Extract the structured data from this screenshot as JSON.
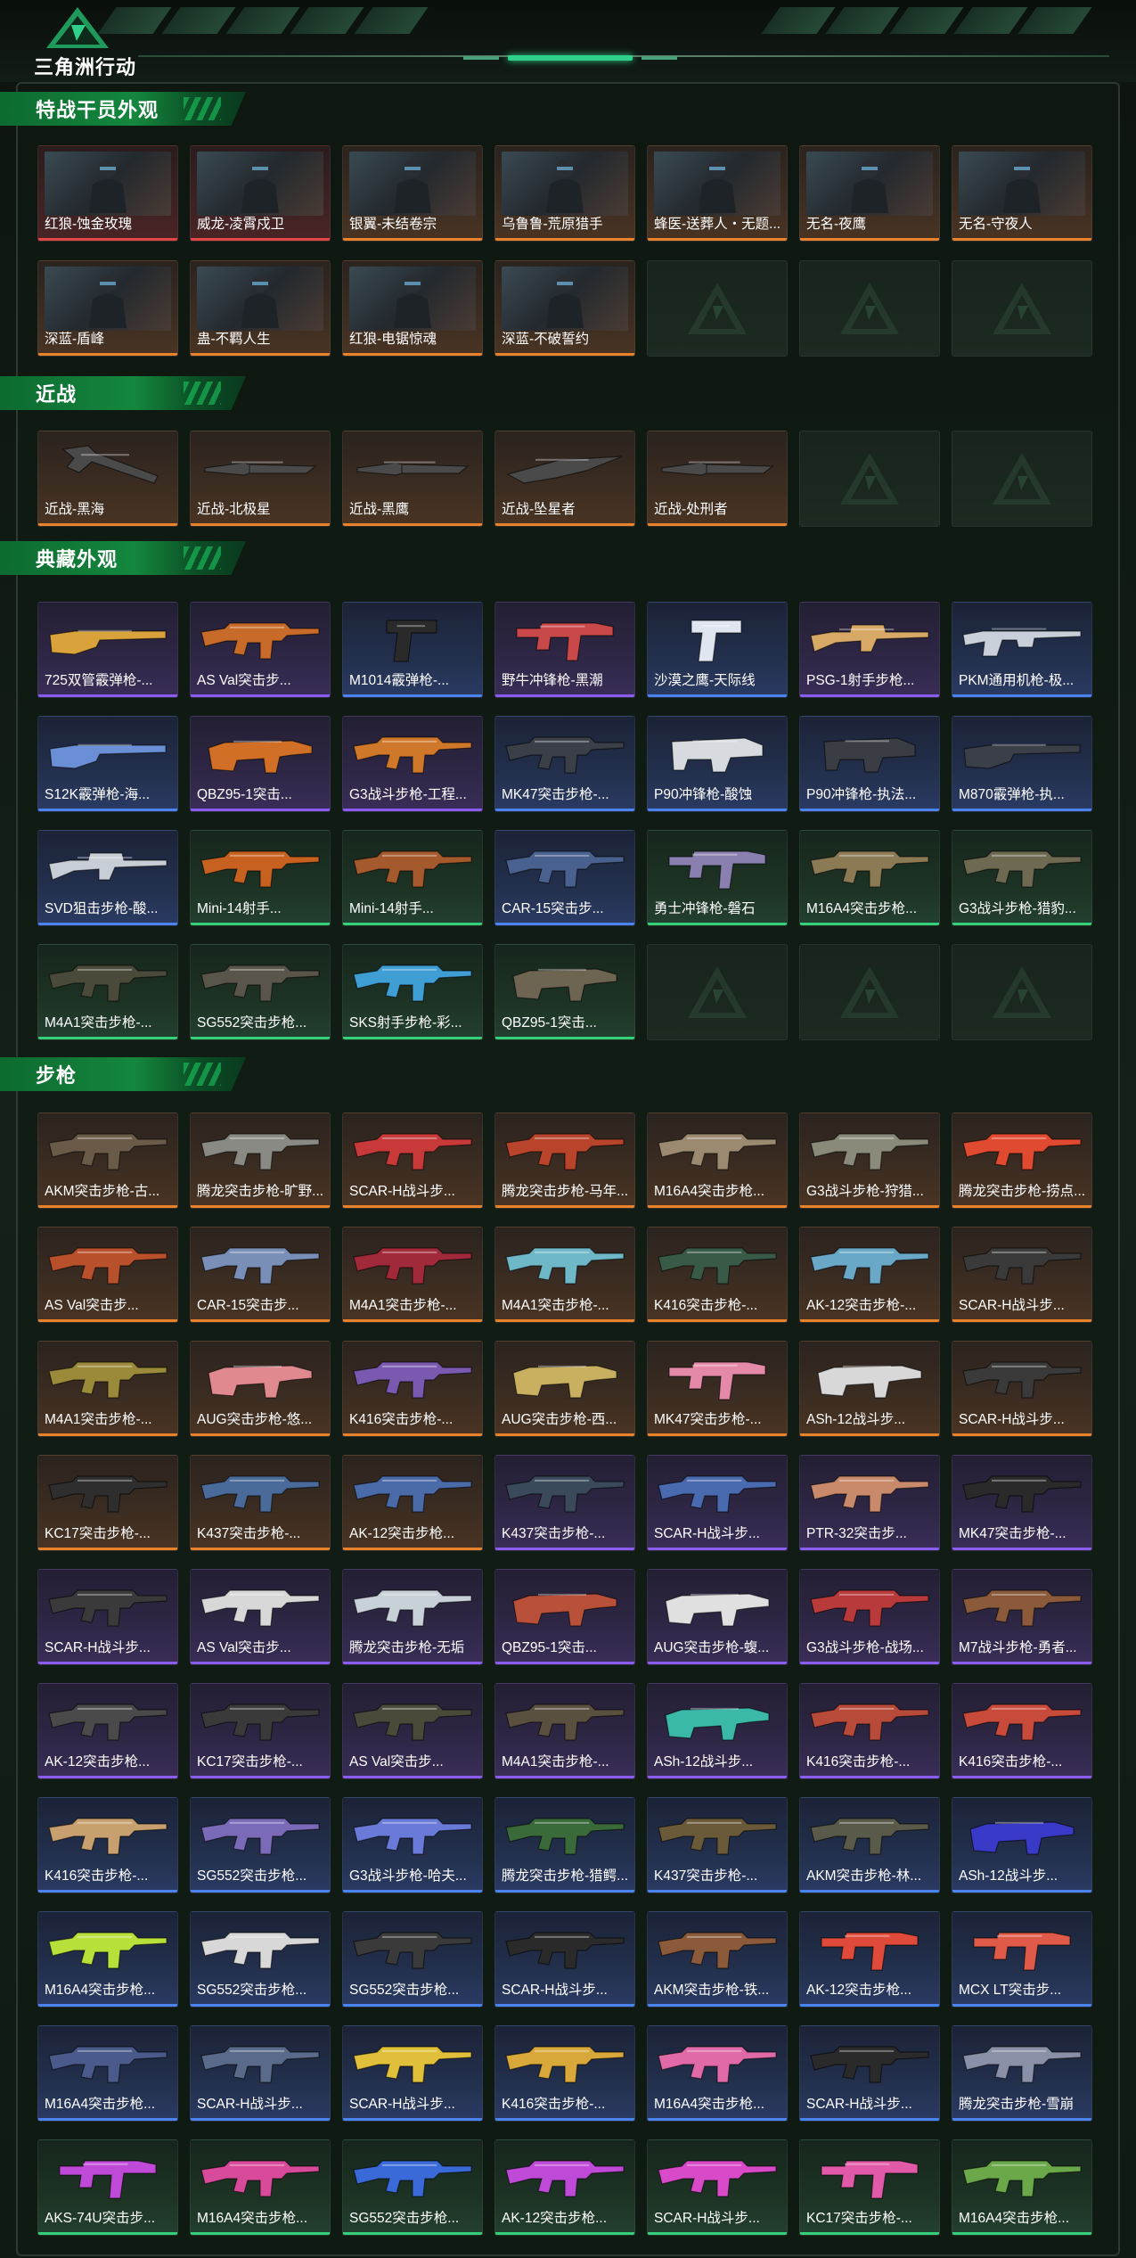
{
  "header": {
    "logo_text": "三角洲行动",
    "logo_icon": "delta-logo-icon"
  },
  "sections": [
    {
      "title": "特战干员外观",
      "items": [
        {
          "label": "红狼-蚀金玫瑰",
          "rarity": "red",
          "kind": "agent",
          "banner": "蚀金玫瑰"
        },
        {
          "label": "威龙-凌霄戍卫",
          "rarity": "red",
          "kind": "agent",
          "banner": "凌霄戍卫"
        },
        {
          "label": "银翼-未结卷宗",
          "rarity": "orange",
          "kind": "agent",
          "banner": "未结卷宗"
        },
        {
          "label": "乌鲁鲁-荒原猎手",
          "rarity": "orange",
          "kind": "agent",
          "banner": "荒原猎手"
        },
        {
          "label": "蜂医-送葬人・无题...",
          "rarity": "orange",
          "kind": "agent",
          "banner": "送葬人"
        },
        {
          "label": "无名-夜鹰",
          "rarity": "orange",
          "kind": "agent",
          "banner": "夜鹰"
        },
        {
          "label": "无名-守夜人",
          "rarity": "orange",
          "kind": "agent",
          "banner": "守夜人"
        },
        {
          "label": "深蓝-盾峰",
          "rarity": "orange",
          "kind": "agent",
          "banner": "盾峰"
        },
        {
          "label": "蛊-不羁人生",
          "rarity": "orange",
          "kind": "agent",
          "banner": "不羁人生"
        },
        {
          "label": "红狼-电锯惊魂",
          "rarity": "orange",
          "kind": "agent",
          "banner": "电锯惊魂"
        },
        {
          "label": "深蓝-不破誓约",
          "rarity": "orange",
          "kind": "agent",
          "banner": "不破誓约"
        },
        {
          "label": "",
          "rarity": "empty",
          "kind": "empty"
        },
        {
          "label": "",
          "rarity": "empty",
          "kind": "empty"
        },
        {
          "label": "",
          "rarity": "empty",
          "kind": "empty"
        }
      ]
    },
    {
      "title": "近战",
      "items": [
        {
          "label": "近战-黑海",
          "rarity": "orange",
          "kind": "axe"
        },
        {
          "label": "近战-北极星",
          "rarity": "orange",
          "kind": "knife"
        },
        {
          "label": "近战-黑鹰",
          "rarity": "orange",
          "kind": "knife"
        },
        {
          "label": "近战-坠星者",
          "rarity": "orange",
          "kind": "blade"
        },
        {
          "label": "近战-处刑者",
          "rarity": "orange",
          "kind": "knife"
        },
        {
          "label": "",
          "rarity": "empty",
          "kind": "empty"
        },
        {
          "label": "",
          "rarity": "empty",
          "kind": "empty"
        }
      ]
    },
    {
      "title": "典藏外观",
      "items": [
        {
          "label": "725双管霰弹枪-...",
          "rarity": "purple",
          "kind": "shotgun",
          "color": "#d9a23a"
        },
        {
          "label": "AS Val突击步...",
          "rarity": "purple",
          "kind": "rifle",
          "color": "#c76a2a"
        },
        {
          "label": "M1014霰弹枪-...",
          "rarity": "blue",
          "kind": "pistol",
          "color": "#2a2a2a"
        },
        {
          "label": "野牛冲锋枪-黑潮",
          "rarity": "purple",
          "kind": "smg",
          "color": "#c9494a"
        },
        {
          "label": "沙漠之鹰-天际线",
          "rarity": "blue",
          "kind": "pistol",
          "color": "#e0e6ef"
        },
        {
          "label": "PSG-1射手步枪...",
          "rarity": "purple",
          "kind": "sniper",
          "color": "#d8a866"
        },
        {
          "label": "PKM通用机枪-极...",
          "rarity": "blue",
          "kind": "mg",
          "color": "#c9d0da"
        },
        {
          "label": "S12K霰弹枪-海...",
          "rarity": "blue",
          "kind": "shotgun",
          "color": "#6b8fd6"
        },
        {
          "label": "QBZ95-1突击...",
          "rarity": "purple",
          "kind": "bullpup",
          "color": "#d06f25"
        },
        {
          "label": "G3战斗步枪-工程...",
          "rarity": "purple",
          "kind": "rifle",
          "color": "#d0782a"
        },
        {
          "label": "MK47突击步枪-...",
          "rarity": "blue",
          "kind": "rifle",
          "color": "#3a3f48"
        },
        {
          "label": "P90冲锋枪-酸蚀",
          "rarity": "blue",
          "kind": "p90",
          "color": "#d7dbe0"
        },
        {
          "label": "P90冲锋枪-执法...",
          "rarity": "blue",
          "kind": "p90",
          "color": "#3a3d44"
        },
        {
          "label": "M870霰弹枪-执...",
          "rarity": "blue",
          "kind": "shotgun",
          "color": "#3a3f48"
        },
        {
          "label": "SVD狙击步枪-酸...",
          "rarity": "blue",
          "kind": "sniper",
          "color": "#c8ced6"
        },
        {
          "label": "Mini-14射手...",
          "rarity": "green",
          "kind": "rifle",
          "color": "#c7611f"
        },
        {
          "label": "Mini-14射手...",
          "rarity": "green",
          "kind": "rifle",
          "color": "#a45a2c"
        },
        {
          "label": "CAR-15突击步...",
          "rarity": "blue",
          "kind": "rifle",
          "color": "#49618f"
        },
        {
          "label": "勇士冲锋枪-磐石",
          "rarity": "green",
          "kind": "smg",
          "color": "#8a80b0"
        },
        {
          "label": "M16A4突击步枪...",
          "rarity": "green",
          "kind": "rifle",
          "color": "#8c7a54"
        },
        {
          "label": "G3战斗步枪-猎豹...",
          "rarity": "green",
          "kind": "rifle",
          "color": "#6e6a52"
        },
        {
          "label": "M4A1突击步枪-...",
          "rarity": "green",
          "kind": "rifle",
          "color": "#4a4a3a"
        },
        {
          "label": "SG552突击步枪...",
          "rarity": "green",
          "kind": "rifle",
          "color": "#5a554a"
        },
        {
          "label": "SKS射手步枪-彩...",
          "rarity": "green",
          "kind": "rifle",
          "color": "#3f9fd4"
        },
        {
          "label": "QBZ95-1突击...",
          "rarity": "green",
          "kind": "bullpup",
          "color": "#6e6452"
        },
        {
          "label": "",
          "rarity": "empty",
          "kind": "empty"
        },
        {
          "label": "",
          "rarity": "empty",
          "kind": "empty"
        },
        {
          "label": "",
          "rarity": "empty",
          "kind": "empty"
        }
      ]
    },
    {
      "title": "步枪",
      "items": [
        {
          "label": "AKM突击步枪-古...",
          "rarity": "orange",
          "kind": "rifle",
          "color": "#6a5a48"
        },
        {
          "label": "腾龙突击步枪-旷野...",
          "rarity": "orange",
          "kind": "rifle",
          "color": "#8a8a84"
        },
        {
          "label": "SCAR-H战斗步...",
          "rarity": "orange",
          "kind": "rifle",
          "color": "#c83a3a"
        },
        {
          "label": "腾龙突击步枪-马年...",
          "rarity": "orange",
          "kind": "rifle",
          "color": "#b8442c"
        },
        {
          "label": "M16A4突击步枪...",
          "rarity": "orange",
          "kind": "rifle",
          "color": "#9c8a70"
        },
        {
          "label": "G3战斗步枪-狩猎...",
          "rarity": "orange",
          "kind": "rifle",
          "color": "#8a8a7a"
        },
        {
          "label": "腾龙突击步枪-捞点...",
          "rarity": "orange",
          "kind": "rifle",
          "color": "#e04a30"
        },
        {
          "label": "AS Val突击步...",
          "rarity": "orange",
          "kind": "rifle",
          "color": "#b8502c"
        },
        {
          "label": "CAR-15突击步...",
          "rarity": "orange",
          "kind": "rifle",
          "color": "#7a8fb8"
        },
        {
          "label": "M4A1突击步枪-...",
          "rarity": "orange",
          "kind": "rifle",
          "color": "#a02a3a"
        },
        {
          "label": "M4A1突击步枪-...",
          "rarity": "orange",
          "kind": "rifle",
          "color": "#6fb8c8"
        },
        {
          "label": "K416突击步枪-...",
          "rarity": "orange",
          "kind": "rifle",
          "color": "#3a5a48"
        },
        {
          "label": "AK-12突击步枪-...",
          "rarity": "orange",
          "kind": "rifle",
          "color": "#6aa8c8"
        },
        {
          "label": "SCAR-H战斗步...",
          "rarity": "orange",
          "kind": "rifle",
          "color": "#3a3a3a"
        },
        {
          "label": "M4A1突击步枪-...",
          "rarity": "orange",
          "kind": "rifle",
          "color": "#9a8a3a"
        },
        {
          "label": "AUG突击步枪-悠...",
          "rarity": "orange",
          "kind": "bullpup",
          "color": "#e08a90"
        },
        {
          "label": "K416突击步枪-...",
          "rarity": "orange",
          "kind": "rifle",
          "color": "#7a5ab0"
        },
        {
          "label": "AUG突击步枪-西...",
          "rarity": "orange",
          "kind": "bullpup",
          "color": "#c8b060"
        },
        {
          "label": "MK47突击步枪-...",
          "rarity": "orange",
          "kind": "smg",
          "color": "#e48aa8"
        },
        {
          "label": "ASh-12战斗步...",
          "rarity": "orange",
          "kind": "bullpup",
          "color": "#d8d8d8"
        },
        {
          "label": "SCAR-H战斗步...",
          "rarity": "orange",
          "kind": "rifle",
          "color": "#3a3a3a"
        },
        {
          "label": "KC17突击步枪-...",
          "rarity": "orange",
          "kind": "rifle",
          "color": "#2e2e2e"
        },
        {
          "label": "K437突击步枪-...",
          "rarity": "orange",
          "kind": "rifle",
          "color": "#4a6a9a"
        },
        {
          "label": "AK-12突击步枪...",
          "rarity": "orange",
          "kind": "rifle",
          "color": "#4a6aa8"
        },
        {
          "label": "K437突击步枪-...",
          "rarity": "purple",
          "kind": "rifle",
          "color": "#3a4a5a"
        },
        {
          "label": "SCAR-H战斗步...",
          "rarity": "purple",
          "kind": "rifle",
          "color": "#4a6ab0"
        },
        {
          "label": "PTR-32突击步...",
          "rarity": "purple",
          "kind": "rifle",
          "color": "#c88a6a"
        },
        {
          "label": "MK47突击步枪-...",
          "rarity": "purple",
          "kind": "rifle",
          "color": "#2a2a2a"
        },
        {
          "label": "SCAR-H战斗步...",
          "rarity": "purple",
          "kind": "rifle",
          "color": "#3a3a3a"
        },
        {
          "label": "AS Val突击步...",
          "rarity": "purple",
          "kind": "rifle",
          "color": "#d8d8d8"
        },
        {
          "label": "腾龙突击步枪-无垢",
          "rarity": "purple",
          "kind": "rifle",
          "color": "#c8d0d8"
        },
        {
          "label": "QBZ95-1突击...",
          "rarity": "purple",
          "kind": "bullpup",
          "color": "#b8503a"
        },
        {
          "label": "AUG突击步枪-蝮...",
          "rarity": "purple",
          "kind": "bullpup",
          "color": "#e0e0e0"
        },
        {
          "label": "G3战斗步枪-战场...",
          "rarity": "purple",
          "kind": "rifle",
          "color": "#b83a3a"
        },
        {
          "label": "M7战斗步枪-勇者...",
          "rarity": "purple",
          "kind": "rifle",
          "color": "#8a5a3a"
        },
        {
          "label": "AK-12突击步枪...",
          "rarity": "purple",
          "kind": "rifle",
          "color": "#4a4a4a"
        },
        {
          "label": "KC17突击步枪-...",
          "rarity": "purple",
          "kind": "rifle",
          "color": "#3a3a3a"
        },
        {
          "label": "AS Val突击步...",
          "rarity": "purple",
          "kind": "rifle",
          "color": "#4a4a3a"
        },
        {
          "label": "M4A1突击步枪-...",
          "rarity": "purple",
          "kind": "rifle",
          "color": "#5a5040"
        },
        {
          "label": "ASh-12战斗步...",
          "rarity": "purple",
          "kind": "bullpup",
          "color": "#3ab8a8"
        },
        {
          "label": "K416突击步枪-...",
          "rarity": "purple",
          "kind": "rifle",
          "color": "#b84a3a"
        },
        {
          "label": "K416突击步枪-...",
          "rarity": "purple",
          "kind": "rifle",
          "color": "#c84a3a"
        },
        {
          "label": "K416突击步枪-...",
          "rarity": "blue",
          "kind": "rifle",
          "color": "#c8a070"
        },
        {
          "label": "SG552突击步枪...",
          "rarity": "blue",
          "kind": "rifle",
          "color": "#7a6ab8"
        },
        {
          "label": "G3战斗步枪-哈夫...",
          "rarity": "blue",
          "kind": "rifle",
          "color": "#6a7ad8"
        },
        {
          "label": "腾龙突击步枪-猎鳄...",
          "rarity": "blue",
          "kind": "rifle",
          "color": "#3a6a3a"
        },
        {
          "label": "K437突击步枪-...",
          "rarity": "blue",
          "kind": "rifle",
          "color": "#6a5a3a"
        },
        {
          "label": "AKM突击步枪-林...",
          "rarity": "blue",
          "kind": "rifle",
          "color": "#5a5a4a"
        },
        {
          "label": "ASh-12战斗步...",
          "rarity": "blue",
          "kind": "bullpup",
          "color": "#3a3ac8"
        },
        {
          "label": "M16A4突击步枪...",
          "rarity": "blue",
          "kind": "rifle",
          "color": "#b8e03a"
        },
        {
          "label": "SG552突击步枪...",
          "rarity": "blue",
          "kind": "rifle",
          "color": "#d8d8d8"
        },
        {
          "label": "SG552突击步枪...",
          "rarity": "blue",
          "kind": "rifle",
          "color": "#3a3a3a"
        },
        {
          "label": "SCAR-H战斗步...",
          "rarity": "blue",
          "kind": "rifle",
          "color": "#2a2a2a"
        },
        {
          "label": "AKM突击步枪-铁...",
          "rarity": "blue",
          "kind": "rifle",
          "color": "#8a5a3a"
        },
        {
          "label": "AK-12突击步枪...",
          "rarity": "blue",
          "kind": "smg",
          "color": "#e04a3a"
        },
        {
          "label": "MCX LT突击步...",
          "rarity": "blue",
          "kind": "smg",
          "color": "#e05a4a"
        },
        {
          "label": "M16A4突击步枪...",
          "rarity": "blue",
          "kind": "rifle",
          "color": "#4a5a8a"
        },
        {
          "label": "SCAR-H战斗步...",
          "rarity": "blue",
          "kind": "rifle",
          "color": "#5a6a8a"
        },
        {
          "label": "SCAR-H战斗步...",
          "rarity": "blue",
          "kind": "rifle",
          "color": "#e0c03a"
        },
        {
          "label": "K416突击步枪-...",
          "rarity": "blue",
          "kind": "rifle",
          "color": "#d8a83a"
        },
        {
          "label": "M16A4突击步枪...",
          "rarity": "blue",
          "kind": "rifle",
          "color": "#e06aa8"
        },
        {
          "label": "SCAR-H战斗步...",
          "rarity": "blue",
          "kind": "rifle",
          "color": "#2a2a2a"
        },
        {
          "label": "腾龙突击步枪-雪崩",
          "rarity": "blue",
          "kind": "rifle",
          "color": "#8a90a8"
        },
        {
          "label": "AKS-74U突击步...",
          "rarity": "green",
          "kind": "smg",
          "color": "#c04ad8"
        },
        {
          "label": "M16A4突击步枪...",
          "rarity": "green",
          "kind": "rifle",
          "color": "#d84a9a"
        },
        {
          "label": "SG552突击步枪...",
          "rarity": "green",
          "kind": "rifle",
          "color": "#3a6ad8"
        },
        {
          "label": "AK-12突击步枪...",
          "rarity": "green",
          "kind": "rifle",
          "color": "#c04ad8"
        },
        {
          "label": "SCAR-H战斗步...",
          "rarity": "green",
          "kind": "rifle",
          "color": "#d84ac8"
        },
        {
          "label": "KC17突击步枪-...",
          "rarity": "green",
          "kind": "smg",
          "color": "#e05aa8"
        },
        {
          "label": "M16A4突击步枪...",
          "rarity": "green",
          "kind": "rifle",
          "color": "#6aa84a"
        }
      ]
    }
  ]
}
